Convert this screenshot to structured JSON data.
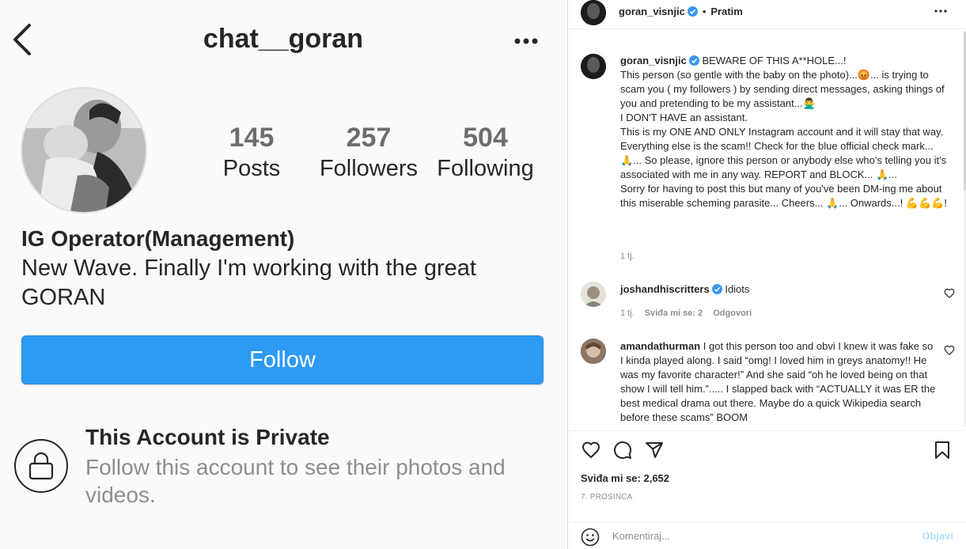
{
  "left": {
    "handle": "chat__goran",
    "stats": [
      {
        "num": "145",
        "label": "Posts"
      },
      {
        "num": "257",
        "label": "Followers"
      },
      {
        "num": "504",
        "label": "Following"
      }
    ],
    "bio_name": "IG Operator(Management)",
    "bio_text": "New Wave. Finally I'm working with the great GORAN",
    "follow_label": "Follow",
    "private_title": "This Account is Private",
    "private_sub": "Follow this account to see their photos and videos."
  },
  "post": {
    "author": "goran_visnjic",
    "follow_state": "Pratim",
    "caption_lines": [
      "BEWARE OF THIS A**HOLE...!",
      "This person (so gentle with the baby on the photo)...😡... is trying to scam you ( my followers ) by sending direct messages, asking things of you and pretending to be my assistant...🙅‍♂️",
      "I DON'T HAVE an assistant.",
      "This is my ONE AND ONLY Instagram account and it will stay that way. Everything else is the scam!! Check for the blue official check mark...🙏... So please, ignore this person or anybody else who's telling you it's associated with me in any way. REPORT and BLOCK... 🙏...",
      "Sorry for having to post this but many of you've been DM-ing me about this miserable scheming parasite... Cheers... 🙏... Onwards...! 💪💪💪!"
    ],
    "caption_time": "1 tj.",
    "comments": [
      {
        "user": "joshandhiscritters",
        "text": "Idiots",
        "time": "1 tj.",
        "likes": "Sviđa mi se: 2",
        "reply": "Odgovori"
      },
      {
        "user": "amandathurman",
        "text": "I got this person too and obvi I knew it was fake so I kinda played along. I said “omg! I loved him in greys anatomy!! He was my favorite character!” And she said “oh he loved being on that show I will tell him.”..... I slapped back with “ACTUALLY it was ER the best medical drama out there. Maybe do a quick Wikipedia search before these scams” BOOM"
      }
    ],
    "likes_count": "Sviđa mi se: 2,652",
    "date": "7. PROSINCA",
    "comment_placeholder": "Komentiraj...",
    "post_label": "Objavi"
  },
  "colors": {
    "follow_button": "#2d9af4",
    "verified_badge": "#3897f0",
    "muted_text": "#8e8e8e",
    "post_link": "#b2dffc"
  },
  "icons": [
    "back-chevron-icon",
    "more-dots-icon",
    "lock-icon",
    "verified-badge-icon",
    "heart-icon",
    "comment-bubble-icon",
    "share-plane-icon",
    "bookmark-icon",
    "emoji-icon"
  ]
}
